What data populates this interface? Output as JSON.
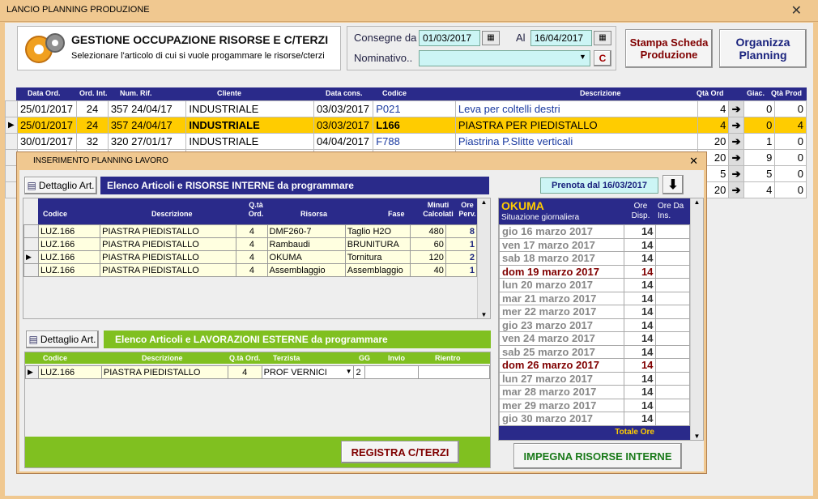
{
  "window": {
    "title": "LANCIO PLANNING PRODUZIONE",
    "close": "✕"
  },
  "header": {
    "title": "GESTIONE OCCUPAZIONE RISORSE E C/TERZI",
    "subtitle": "Selezionare l'articolo di cui si vuole progammare le risorse/cterzi"
  },
  "filters": {
    "consegne_label": "Consegne da",
    "date_from": "01/03/2017",
    "al_label": "Al",
    "date_to": "16/04/2017",
    "nominativo_label": "Nominativo..",
    "nominativo_value": "",
    "c_label": "C"
  },
  "buttons": {
    "stampa": "Stampa Scheda Produzione",
    "organizza": "Organizza Planning"
  },
  "orders": {
    "columns": [
      "Data Ord.",
      "Ord. Int.",
      "Num. Rif.",
      "Cliente",
      "Data cons.",
      "Codice",
      "Descrizione",
      "Qtà Ord",
      "Giac.",
      "Qtà Prod"
    ],
    "rows": [
      {
        "data": "25/01/2017",
        "ord": "24",
        "rif": "357 24/04/17",
        "cliente": "INDUSTRIALE",
        "cons": "03/03/2017",
        "codice": "P021",
        "desc": "Leva per coltelli destri",
        "qta": "4",
        "giac": "0",
        "prod": "0"
      },
      {
        "data": "25/01/2017",
        "ord": "24",
        "rif": "357 24/04/17",
        "cliente": "INDUSTRIALE",
        "cons": "03/03/2017",
        "codice": "L166",
        "desc": "PIASTRA PER PIEDISTALLO",
        "qta": "4",
        "giac": "0",
        "prod": "4"
      },
      {
        "data": "30/01/2017",
        "ord": "32",
        "rif": "320 27/01/17",
        "cliente": "INDUSTRIALE",
        "cons": "04/04/2017",
        "codice": "F788",
        "desc": "Piastrina P.Slitte verticali",
        "qta": "20",
        "giac": "1",
        "prod": "0"
      },
      {
        "qta": "20",
        "giac": "9",
        "prod": "0"
      },
      {
        "qta": "5",
        "giac": "5",
        "prod": "0"
      },
      {
        "qta": "20",
        "giac": "4",
        "prod": "0"
      }
    ]
  },
  "popup": {
    "title": "INSERIMENTO PLANNING LAVORO",
    "close": "✕",
    "dettaglio1": "Dettaglio Art.",
    "section1": "Elenco Articoli e RISORSE INTERNE da programmare",
    "prenota": "Prenota dal 16/03/2017",
    "int_cols": [
      "Codice",
      "Descrizione",
      "Q.tà Ord.",
      "Risorsa",
      "Fase",
      "Minuti Calcolati",
      "Ore Perv."
    ],
    "int_rows": [
      {
        "codice": "LUZ.166",
        "desc": "PIASTRA PIEDISTALLO",
        "qta": "4",
        "risorsa": "DMF260-7",
        "fase": "Taglio H2O",
        "min": "480",
        "ore": "8"
      },
      {
        "codice": "LUZ.166",
        "desc": "PIASTRA PIEDISTALLO",
        "qta": "4",
        "risorsa": "Rambaudi",
        "fase": "BRUNITURA",
        "min": "60",
        "ore": "1"
      },
      {
        "codice": "LUZ.166",
        "desc": "PIASTRA PIEDISTALLO",
        "qta": "4",
        "risorsa": "OKUMA",
        "fase": "Tornitura",
        "min": "120",
        "ore": "2"
      },
      {
        "codice": "LUZ.166",
        "desc": "PIASTRA PIEDISTALLO",
        "qta": "4",
        "risorsa": "Assemblaggio",
        "fase": "Assemblaggio",
        "min": "40",
        "ore": "1"
      }
    ],
    "dettaglio2": "Dettaglio Art.",
    "section2": "Elenco Articoli e LAVORAZIONI ESTERNE da programmare",
    "ext_cols": [
      "Codice",
      "Descrizione",
      "Q.tà Ord.",
      "Terzista",
      "GG",
      "Invio",
      "Rientro"
    ],
    "ext_row": {
      "codice": "LUZ.166",
      "desc": "PIASTRA PIEDISTALLO",
      "qta": "4",
      "terzista": "PROF VERNICI",
      "gg": "2",
      "invio": "",
      "rientro": ""
    },
    "registra": "REGISTRA C/TERZI",
    "impegna": "IMPEGNA  RISORSE  INTERNE",
    "calendar": {
      "resource": "OKUMA",
      "situazione": "Situazione giornaliera",
      "col_disp": "Ore Disp.",
      "col_ins": "Ore Da Ins.",
      "totale": "Totale Ore",
      "days": [
        {
          "d": "gio 16 marzo 2017",
          "h": "14"
        },
        {
          "d": "ven 17 marzo 2017",
          "h": "14"
        },
        {
          "d": "sab 18 marzo 2017",
          "h": "14"
        },
        {
          "d": "dom 19 marzo 2017",
          "h": "14",
          "sun": true
        },
        {
          "d": "lun 20 marzo 2017",
          "h": "14"
        },
        {
          "d": "mar 21 marzo 2017",
          "h": "14"
        },
        {
          "d": "mer 22 marzo 2017",
          "h": "14"
        },
        {
          "d": "gio 23 marzo 2017",
          "h": "14"
        },
        {
          "d": "ven 24 marzo 2017",
          "h": "14"
        },
        {
          "d": "sab 25 marzo 2017",
          "h": "14"
        },
        {
          "d": "dom 26 marzo 2017",
          "h": "14",
          "sun": true
        },
        {
          "d": "lun 27 marzo 2017",
          "h": "14"
        },
        {
          "d": "mar 28 marzo 2017",
          "h": "14"
        },
        {
          "d": "mer 29 marzo 2017",
          "h": "14"
        },
        {
          "d": "gio 30 marzo 2017",
          "h": "14"
        }
      ]
    }
  }
}
